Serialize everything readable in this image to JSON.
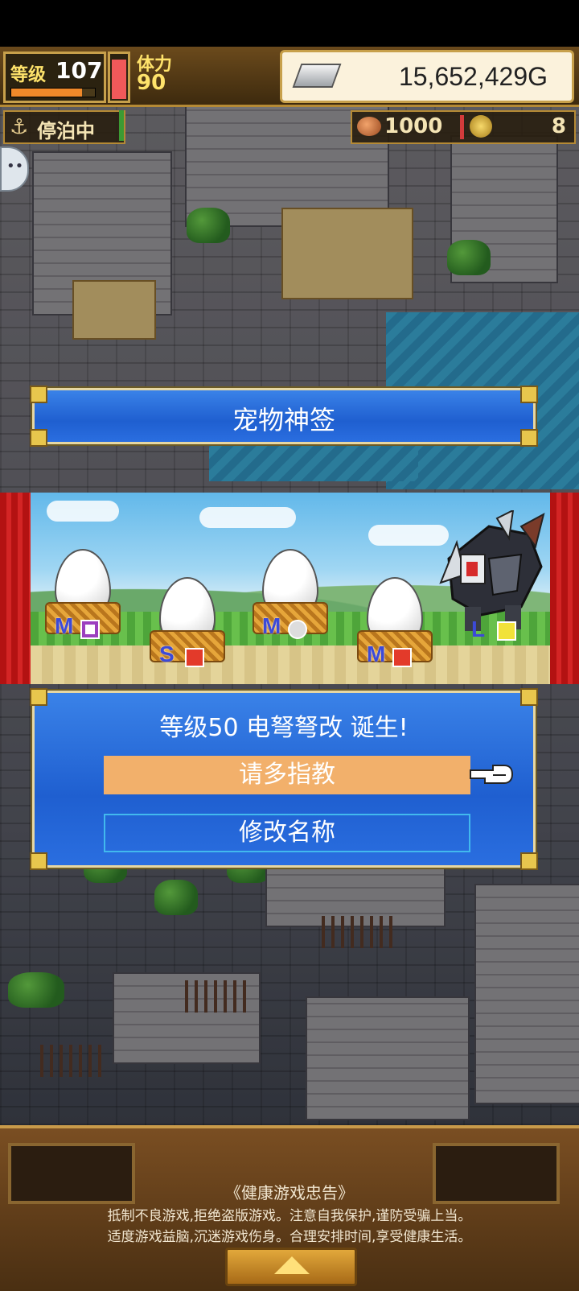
{
  "hud": {
    "level_label": "等级",
    "level_value": "107",
    "level_progress": 0.85,
    "stamina_label": "体力",
    "stamina_value": "90",
    "stamina_level": 0.85,
    "gold_value": "15,652,429G",
    "anchor_icon": "⚓",
    "anchor_label": "停泊中",
    "meat_value": "1000",
    "medal_value": "8"
  },
  "chat_bubble_icon": "••",
  "title": "宠物神签",
  "stage": {
    "eggs": [
      {
        "size": "M",
        "type": "purple-square"
      },
      {
        "size": "S",
        "type": "fire"
      },
      {
        "size": "M",
        "type": "white"
      },
      {
        "size": "M",
        "type": "fire"
      }
    ],
    "dragon_size": "L",
    "dragon_type": "yellow"
  },
  "birth": {
    "message": "等级50 电弩弩改 诞生!",
    "greet_button": "请多指教",
    "rename_button": "修改名称"
  },
  "notice": {
    "title": "《健康游戏忠告》",
    "line1": "抵制不良游戏,拒绝盗版游戏。注意自我保护,谨防受骗上当。",
    "line2": "适度游戏益脑,沉迷游戏伤身。合理安排时间,享受健康生活。"
  },
  "colors": {
    "panel_blue": "#2a6ee0",
    "greet_orange": "#f2b06b",
    "rename_border": "#41b9ee"
  }
}
